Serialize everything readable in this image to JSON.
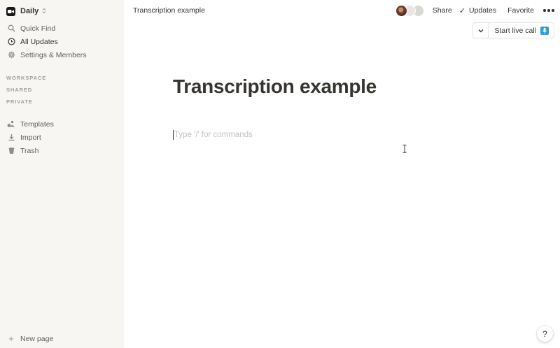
{
  "workspace": {
    "name": "Daily"
  },
  "sidebar": {
    "nav": [
      {
        "label": "Quick Find",
        "icon": "search-icon"
      },
      {
        "label": "All Updates",
        "icon": "clock-icon"
      },
      {
        "label": "Settings & Members",
        "icon": "gear-icon"
      }
    ],
    "sections": [
      "WORKSPACE",
      "SHARED",
      "PRIVATE"
    ],
    "tools": [
      {
        "label": "Templates",
        "icon": "shapes-icon"
      },
      {
        "label": "Import",
        "icon": "download-icon"
      },
      {
        "label": "Trash",
        "icon": "trash-icon"
      }
    ],
    "new_page": "New page"
  },
  "topbar": {
    "breadcrumb": "Transcription example",
    "share": "Share",
    "updates": "Updates",
    "favorite": "Favorite"
  },
  "live_call": {
    "label": "Start live call"
  },
  "page": {
    "title": "Transcription example",
    "placeholder": "Type '/' for commands"
  },
  "help": {
    "label": "?"
  },
  "colors": {
    "sidebar_bg": "#f7f6f3",
    "text": "#37352f",
    "accent": "#2e9ed8"
  }
}
